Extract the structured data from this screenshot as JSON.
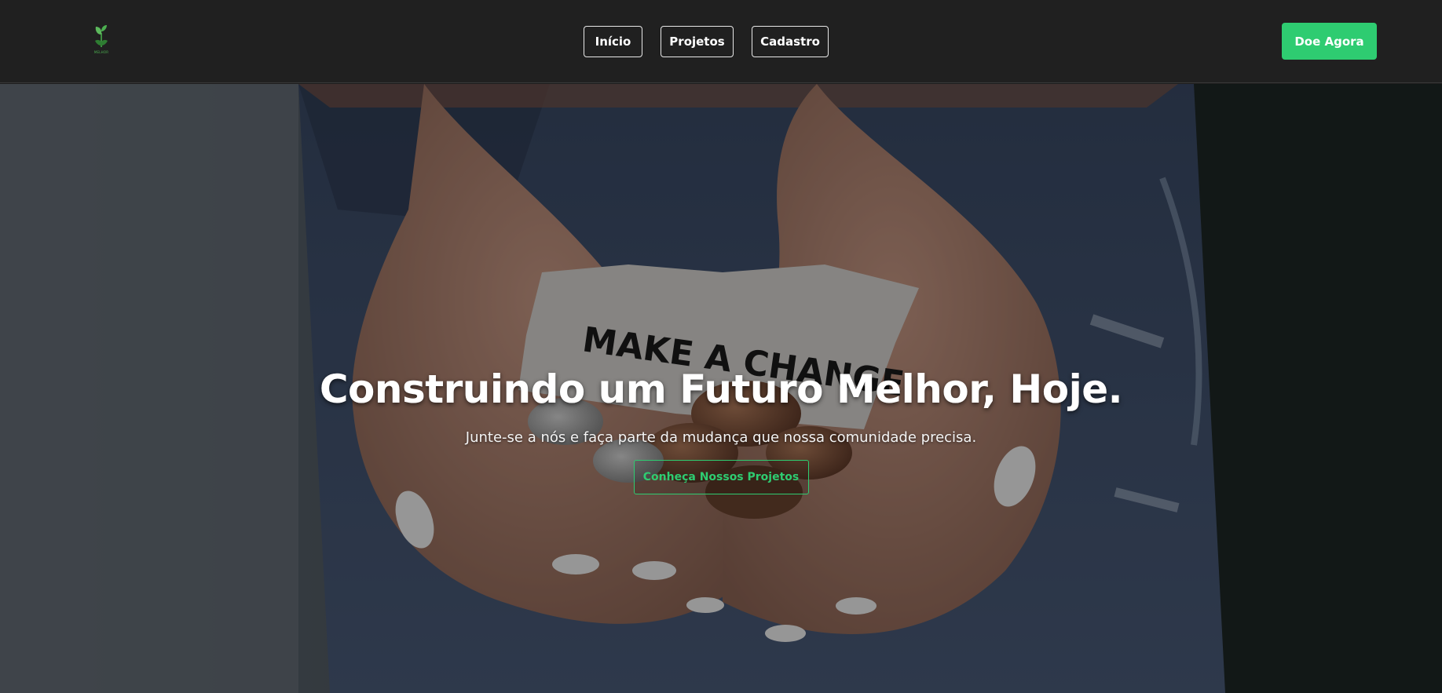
{
  "brand": {
    "logo_icon": "sprout-hand-icon",
    "logo_text": "MELHOR"
  },
  "nav": {
    "items": [
      {
        "label": "Início"
      },
      {
        "label": "Projetos"
      },
      {
        "label": "Cadastro"
      }
    ]
  },
  "header": {
    "donate_label": "Doe Agora"
  },
  "hero": {
    "image_sign_text": "MAKE A CHANGE",
    "title": "Construindo um Futuro Melhor, Hoje.",
    "subtitle": "Junte-se a nós e faça parte da mudança que nossa comunidade precisa.",
    "cta_label": "Conheça Nossos Projetos"
  },
  "colors": {
    "header_bg": "#202020",
    "accent": "#2ecc71",
    "text": "#ffffff"
  }
}
